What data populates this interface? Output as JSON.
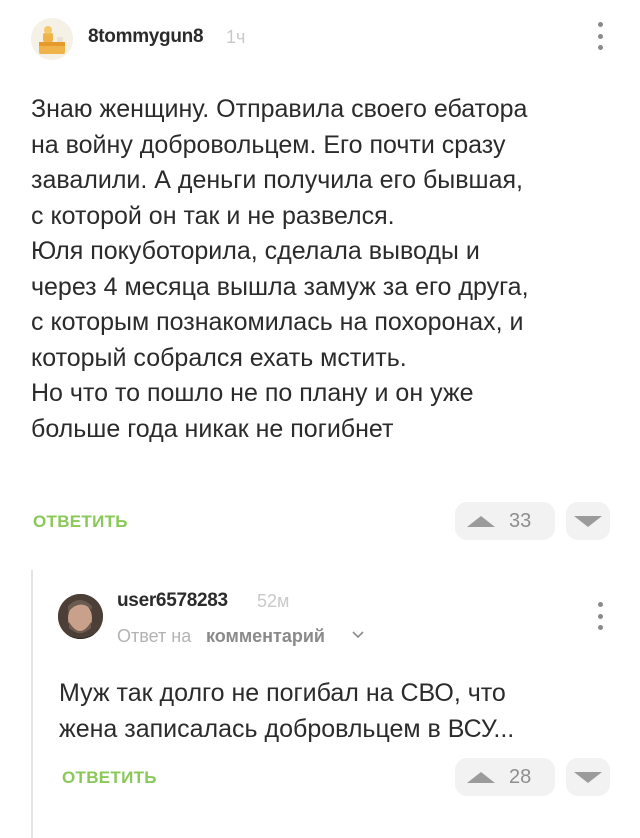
{
  "comment": {
    "username": "8tommygun8",
    "time": "1ч",
    "lines": [
      "Знаю женщину. Отправила своего ебатора",
      "на войну добровольцем. Его почти сразу",
      "завалили. А деньги получила его бывшая,",
      "с которой он так и не развелся.",
      " Юля покуботорила, сделала выводы и",
      "через 4 месяца вышла замуж за его друга,",
      "с которым познакомилась на похоронах, и",
      "который собрался ехать мстить.",
      " Но что то пошло не по плану и он уже",
      "больше года никак не погибнет"
    ],
    "reply_label": "ОТВЕТИТЬ",
    "rating": "33",
    "upvote_icon": "triangle-up-icon",
    "downvote_icon": "triangle-down-icon",
    "menu_icon": "kebab-menu-icon"
  },
  "reply": {
    "username": "user6578283",
    "time": "52м",
    "answer_prefix": "Ответ на",
    "answer_link": "комментарий",
    "answer_icon": "chevron-down-icon",
    "lines": [
      "Муж так долго не погибал на СВО, что",
      "жена записалась добровльцем в ВСУ..."
    ],
    "reply_label": "ОТВЕТИТЬ",
    "rating": "28"
  },
  "colors": {
    "accent_green": "#8ac858",
    "text": "#2b2b2b",
    "muted": "#c9c9c9",
    "vote_bg": "#f2f2f2"
  }
}
